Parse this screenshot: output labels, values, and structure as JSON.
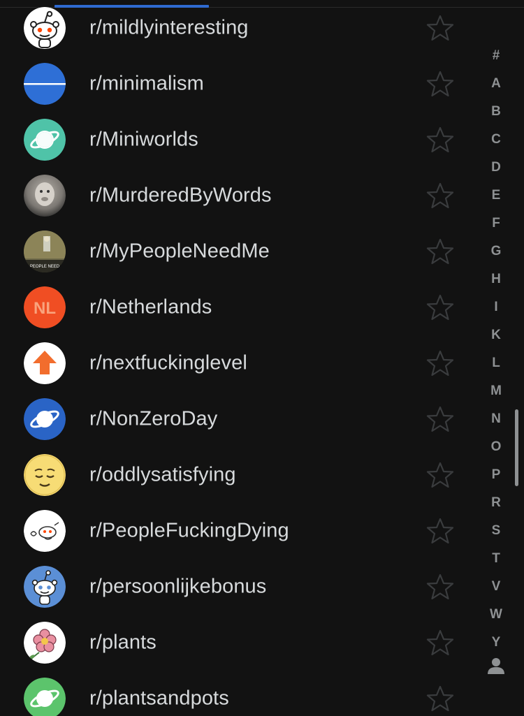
{
  "communities": [
    {
      "name": "r/mildlyinteresting",
      "icon": "snoo-icon"
    },
    {
      "name": "r/minimalism",
      "icon": "minimal-line-icon"
    },
    {
      "name": "r/Miniworlds",
      "icon": "planet-icon"
    },
    {
      "name": "r/MurderedByWords",
      "icon": "photo-avatar-icon"
    },
    {
      "name": "r/MyPeopleNeedMe",
      "icon": "photo-avatar-icon",
      "avatar_caption": "PEOPLE NEED"
    },
    {
      "name": "r/Netherlands",
      "icon": "nl-logo-icon",
      "avatar_text": "NL"
    },
    {
      "name": "r/nextfuckinglevel",
      "icon": "up-arrow-icon"
    },
    {
      "name": "r/NonZeroDay",
      "icon": "planet-icon"
    },
    {
      "name": "r/oddlysatisfying",
      "icon": "relieved-face-icon"
    },
    {
      "name": "r/PeopleFuckingDying",
      "icon": "sketch-snoo-icon"
    },
    {
      "name": "r/persoonlijkebonus",
      "icon": "snoo-icon"
    },
    {
      "name": "r/plants",
      "icon": "flower-icon"
    },
    {
      "name": "r/plantsandpots",
      "icon": "planet-icon"
    }
  ],
  "alpha_index": [
    "#",
    "A",
    "B",
    "C",
    "D",
    "E",
    "F",
    "G",
    "H",
    "I",
    "K",
    "L",
    "M",
    "N",
    "O",
    "P",
    "R",
    "S",
    "T",
    "V",
    "W",
    "Y"
  ],
  "alpha_index_user_icon": "person-icon",
  "colors": {
    "background": "#121212",
    "text": "#d7dadc",
    "muted": "#8e9193",
    "accent": "#2f6ad0",
    "star_outline": "#3a3c3e"
  }
}
